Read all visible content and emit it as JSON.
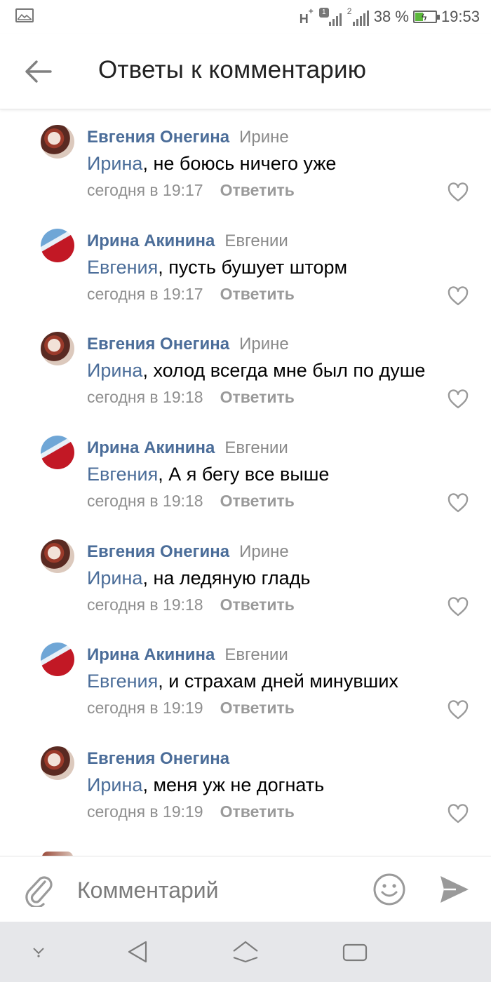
{
  "status_bar": {
    "network_type": "H",
    "network_plus": "+",
    "sim1_badge": "1",
    "sim2_label": "2",
    "battery_percent": "38 %",
    "battery_level": 0.38,
    "time": "19:53",
    "battery_color": "#5bb83b"
  },
  "header": {
    "title": "Ответы к комментарию",
    "back_icon": "arrow-left-icon"
  },
  "colors": {
    "author": "#4b6d99",
    "muted": "#8f8f8f"
  },
  "comments": [
    {
      "author": "Евгения Онегина",
      "to": "Ирине",
      "mention": "Ирина",
      "text": ", не боюсь ничего уже",
      "date": "сегодня в 19:17",
      "reply": "Ответить",
      "avatar": "evgenia"
    },
    {
      "author": "Ирина Акинина",
      "to": "Евгении",
      "mention": "Евгения",
      "text": ", пусть бушует шторм",
      "date": "сегодня в 19:17",
      "reply": "Ответить",
      "avatar": "irina"
    },
    {
      "author": "Евгения Онегина",
      "to": "Ирине",
      "mention": "Ирина",
      "text": ", холод всегда мне был по душе",
      "date": "сегодня в 19:18",
      "reply": "Ответить",
      "avatar": "evgenia"
    },
    {
      "author": "Ирина Акинина",
      "to": "Евгении",
      "mention": "Евгения",
      "text": ", А я бегу все выше",
      "date": "сегодня в 19:18",
      "reply": "Ответить",
      "avatar": "irina"
    },
    {
      "author": "Евгения Онегина",
      "to": "Ирине",
      "mention": "Ирина",
      "text": ", на ледяную гладь",
      "date": "сегодня в 19:18",
      "reply": "Ответить",
      "avatar": "evgenia"
    },
    {
      "author": "Ирина Акинина",
      "to": "Евгении",
      "mention": "Евгения",
      "text": ", и страхам дней минувших",
      "date": "сегодня в 19:19",
      "reply": "Ответить",
      "avatar": "irina"
    },
    {
      "author": "Евгения Онегина",
      "to": "",
      "mention": "Ирина",
      "text": ", меня уж не догнать",
      "date": "сегодня в 19:19",
      "reply": "Ответить",
      "avatar": "evgenia"
    }
  ],
  "composer": {
    "placeholder": "Комментарий",
    "attach_icon": "paperclip-icon",
    "emoji_icon": "smile-icon",
    "send_icon": "send-icon"
  },
  "navbar": {
    "icons": [
      "chevron-down-icon",
      "back-triangle-icon",
      "home-icon",
      "recents-icon"
    ]
  }
}
